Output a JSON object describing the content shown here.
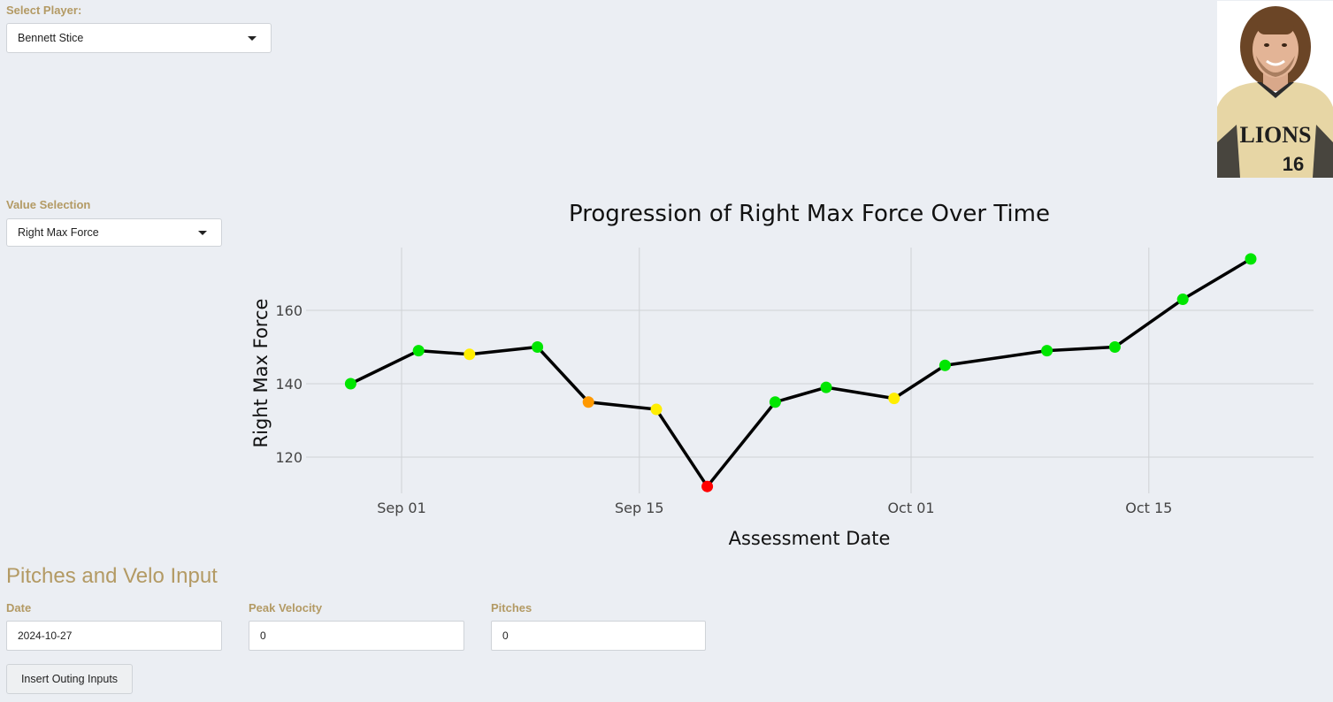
{
  "player": {
    "label": "Select Player:",
    "selected": "Bennett Stice"
  },
  "value_selection": {
    "label": "Value Selection",
    "selected": "Right Max Force"
  },
  "photo": {
    "jersey_text": "LIONS",
    "jersey_number": "16"
  },
  "inputs": {
    "section_title": "Pitches and Velo Input",
    "date_label": "Date",
    "date_value": "2024-10-27",
    "velocity_label": "Peak Velocity",
    "velocity_value": "0",
    "pitches_label": "Pitches",
    "pitches_value": "0",
    "insert_button": "Insert Outing Inputs"
  },
  "chart_data": {
    "type": "line",
    "title": "Progression of Right Max Force Over Time",
    "xlabel": "Assessment Date",
    "ylabel": "Right Max Force",
    "x_ticks": [
      "Sep 01",
      "Sep 15",
      "Oct 01",
      "Oct 15"
    ],
    "y_ticks": [
      120,
      140,
      160
    ],
    "grid": true,
    "points": [
      {
        "x": "2024-08-29",
        "y": 140,
        "color": "#00e600"
      },
      {
        "x": "2024-09-02",
        "y": 149,
        "color": "#00e600"
      },
      {
        "x": "2024-09-05",
        "y": 148,
        "color": "#ffee00"
      },
      {
        "x": "2024-09-09",
        "y": 150,
        "color": "#00e600"
      },
      {
        "x": "2024-09-12",
        "y": 135,
        "color": "#ff9900"
      },
      {
        "x": "2024-09-16",
        "y": 133,
        "color": "#ffee00"
      },
      {
        "x": "2024-09-19",
        "y": 112,
        "color": "#ff0000"
      },
      {
        "x": "2024-09-23",
        "y": 135,
        "color": "#00e600"
      },
      {
        "x": "2024-09-26",
        "y": 139,
        "color": "#00e600"
      },
      {
        "x": "2024-09-30",
        "y": 136,
        "color": "#ffee00"
      },
      {
        "x": "2024-10-03",
        "y": 145,
        "color": "#00e600"
      },
      {
        "x": "2024-10-09",
        "y": 149,
        "color": "#00e600"
      },
      {
        "x": "2024-10-13",
        "y": 150,
        "color": "#00e600"
      },
      {
        "x": "2024-10-17",
        "y": 163,
        "color": "#00e600"
      },
      {
        "x": "2024-10-21",
        "y": 174,
        "color": "#00e600"
      }
    ]
  }
}
